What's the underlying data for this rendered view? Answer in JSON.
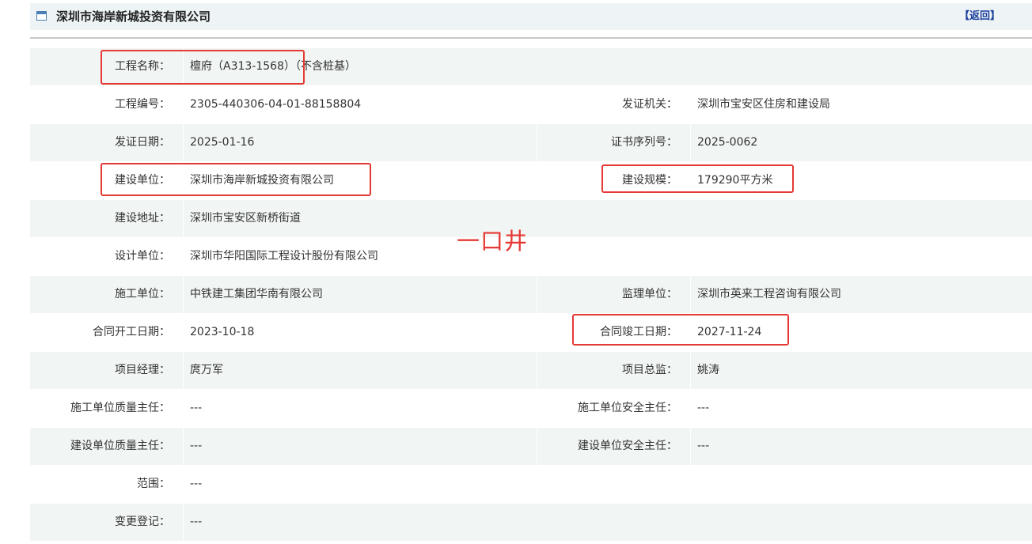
{
  "header": {
    "title": "深圳市海岸新城投资有限公司",
    "back_label": "【返回】",
    "icon": "window-icon"
  },
  "annotation": "一口井",
  "rows": [
    {
      "label1": "工程名称：",
      "value1": "檀府（A313-1568）（不含桩基）",
      "label2": "",
      "value2": ""
    },
    {
      "label1": "工程编号：",
      "value1": "2305-440306-04-01-88158804",
      "label2": "发证机关：",
      "value2": "深圳市宝安区住房和建设局"
    },
    {
      "label1": "发证日期：",
      "value1": "2025-01-16",
      "label2": "证书序列号：",
      "value2": "2025-0062"
    },
    {
      "label1": "建设单位：",
      "value1": "深圳市海岸新城投资有限公司",
      "label2": "建设规模：",
      "value2": "179290平方米"
    },
    {
      "label1": "建设地址：",
      "value1": "深圳市宝安区新桥街道",
      "label2": "",
      "value2": ""
    },
    {
      "label1": "设计单位：",
      "value1": "深圳市华阳国际工程设计股份有限公司",
      "label2": "",
      "value2": ""
    },
    {
      "label1": "施工单位：",
      "value1": "中铁建工集团华南有限公司",
      "label2": "监理单位：",
      "value2": "深圳市英来工程咨询有限公司"
    },
    {
      "label1": "合同开工日期：",
      "value1": "2023-10-18",
      "label2": "合同竣工日期：",
      "value2": "2027-11-24"
    },
    {
      "label1": "项目经理：",
      "value1": "庹万军",
      "label2": "项目总监：",
      "value2": "姚涛"
    },
    {
      "label1": "施工单位质量主任：",
      "value1": "---",
      "label2": "施工单位安全主任：",
      "value2": "---"
    },
    {
      "label1": "建设单位质量主任：",
      "value1": "---",
      "label2": "建设单位安全主任：",
      "value2": "---"
    },
    {
      "label1": "范围：",
      "value1": "---",
      "label2": "",
      "value2": ""
    },
    {
      "label1": "变更登记：",
      "value1": "---",
      "label2": "",
      "value2": ""
    }
  ],
  "highlight_color": "#e53935"
}
